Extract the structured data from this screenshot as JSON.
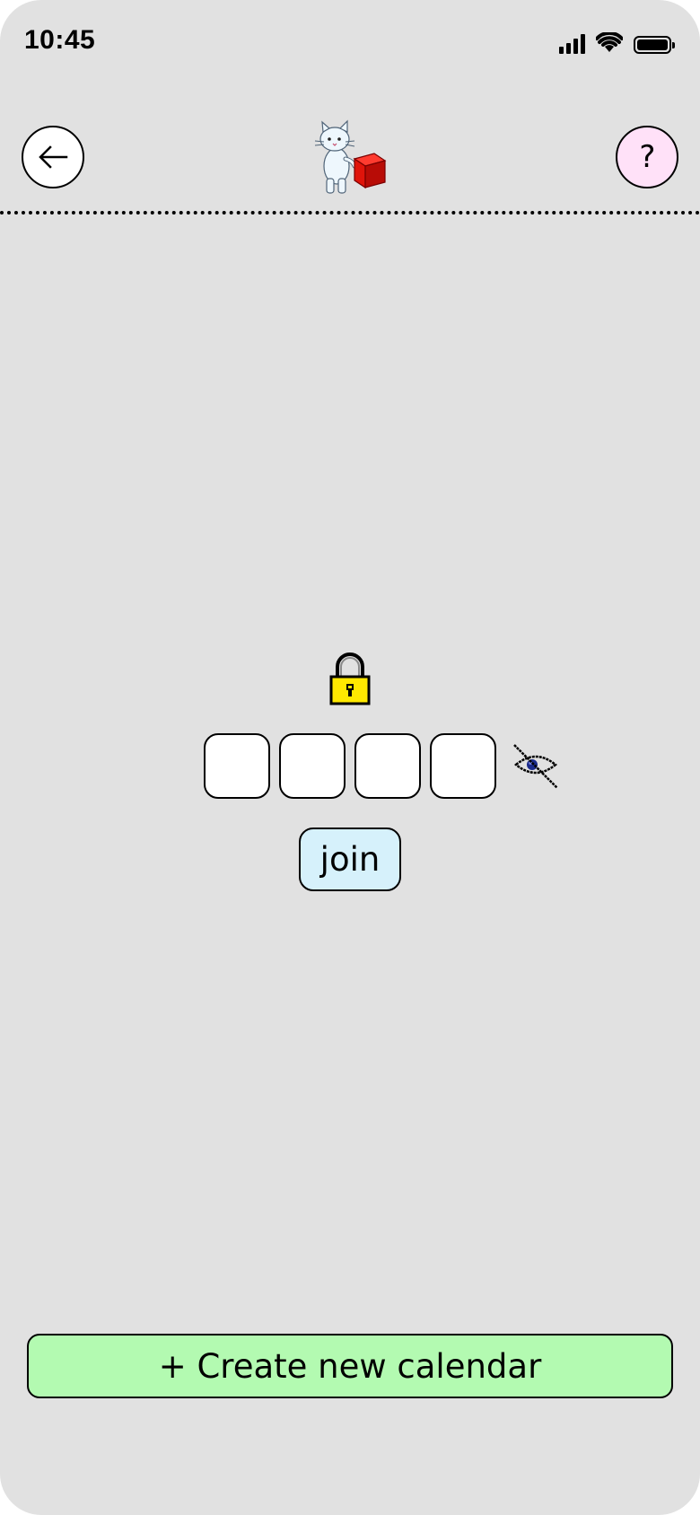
{
  "status_bar": {
    "time": "10:45",
    "icons": [
      "cellular-signal-icon",
      "wifi-icon",
      "battery-icon"
    ]
  },
  "header": {
    "back_icon": "arrow-left-icon",
    "logo": "cat-with-red-box-mascot",
    "help_label": "?"
  },
  "pin_entry": {
    "lock_icon": "padlock-icon",
    "digits": [
      "",
      "",
      "",
      ""
    ],
    "visibility_icon": "eye-hidden-icon",
    "join_label": "join"
  },
  "footer": {
    "create_label": "+ Create new calendar"
  },
  "colors": {
    "background": "#e1e1e1",
    "help_button": "#ffe1f8",
    "join_button": "#d6f1fb",
    "create_button": "#b3fab1",
    "lock_yellow": "#ffe800"
  }
}
